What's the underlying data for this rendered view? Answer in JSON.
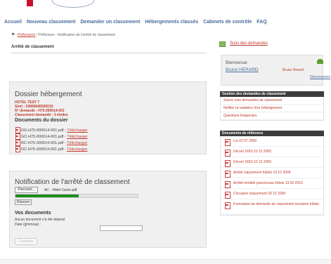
{
  "nav": {
    "items": [
      "Accueil",
      "Nouveau classement",
      "Demander un classement",
      "Hébergements classés",
      "Cabinets de contrôle",
      "FAQ"
    ]
  },
  "breadcrumb": {
    "link": "Préfectures",
    "rest": " / Préfecture - Notification de l'arrêté de classement"
  },
  "page_title": "Arrêté de classement",
  "dossier": {
    "title": "Dossier hébergement",
    "hotel": "HOTEL TEST 7",
    "siret": "Siret : 34006645500015",
    "demande": "N° demande : H75.000014-001",
    "classement": "Classement demandé : 3 étoiles",
    "docs_title": "Documents du dossier",
    "docs": [
      {
        "name": "DG-H75-000014-001.pdf - ",
        "link": "Télécharger"
      },
      {
        "name": "GC-H75-000014-001.pdf - ",
        "link": "Télécharger"
      },
      {
        "name": "RC-H75-000014-001.pdf - ",
        "link": "Télécharger"
      },
      {
        "name": "DC-H75-000014-001.pdf - ",
        "link": "Télécharger"
      }
    ]
  },
  "notification": {
    "title": "Notification de l'arrêté de classement",
    "browse": "Parcourir...",
    "file_name": "AC - Hôtel Caron.pdf",
    "progress": 0.52,
    "upload": "Déposer",
    "docs_title": "Vos documents",
    "no_doc": "Aucun document n'a été déposé",
    "date_label": "Date (jj/mm/aa) :",
    "date_value": "",
    "continue": "Continuer"
  },
  "sidebar": {
    "suivi": "Suivi des demandes",
    "welcome": "Bienvenue",
    "user_name": "Bruno HERARD",
    "user_label": "Bruno Herard",
    "logout": "Déconnexion",
    "gestion_title": "Gestion des demandes de classement",
    "gestion_items": [
      "Suivre mes demandes de classement",
      "Notifier la radiation d'un hébergement",
      "Questions fréquentes"
    ],
    "ref_title": "Documents de référence",
    "ref_items": [
      "Loi 22 07 2009",
      "Décret 1652-23 12 2009",
      "Décret 1652-23 12 2009",
      "Arrêté classement hôtels 23 12 2009",
      "Arrêté modèle panonceau hôtels 19 02 2010",
      "Circulaire classement 20 12 2009",
      "Formulaire de demande de classement tourisme hôtels"
    ]
  },
  "colors": {
    "accent_red": "#c0392b",
    "nav_blue": "#4a6c9b",
    "progress_green": "#1e8c1e",
    "sidebar_header": "#3c3c3c"
  }
}
